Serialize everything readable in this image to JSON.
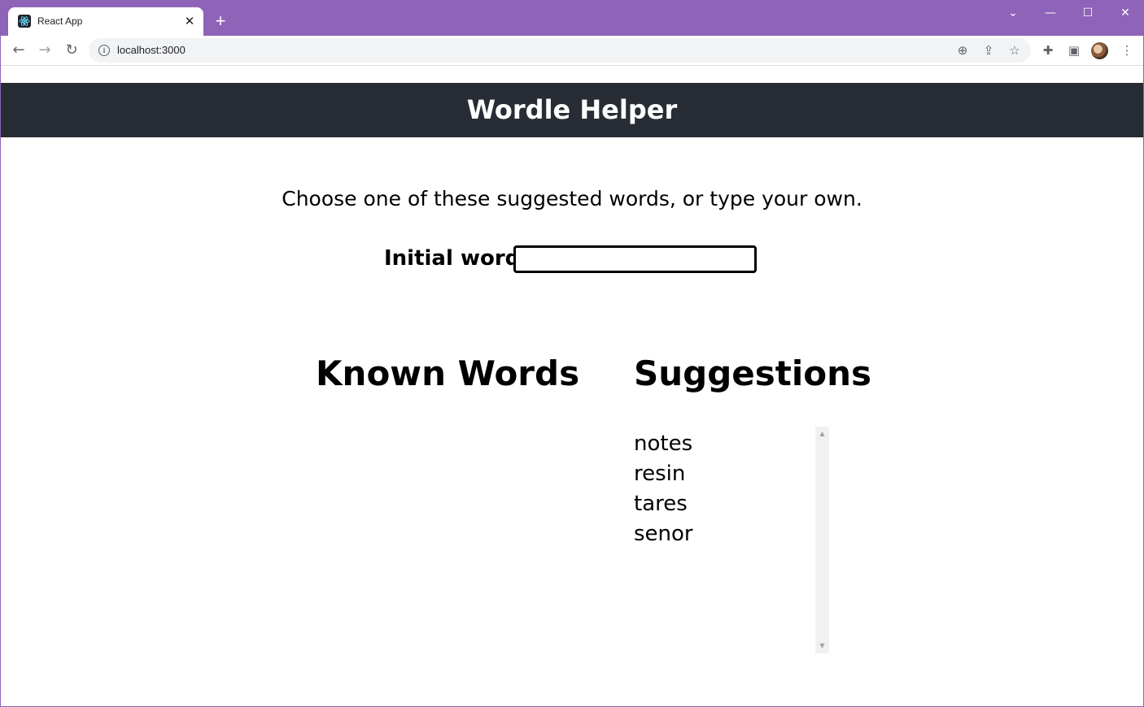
{
  "browser": {
    "tab_title": "React App",
    "tab_close": "✕",
    "new_tab": "+",
    "url": "localhost:3000",
    "window_controls": {
      "tab_search": "⌄",
      "minimize": "—",
      "maximize": "☐",
      "close": "✕"
    },
    "nav": {
      "back": "←",
      "forward": "→",
      "reload": "↻"
    },
    "omnibox_icons": {
      "zoom": "⊕",
      "share": "⇪",
      "bookmark": "☆"
    },
    "toolbar_icons": {
      "extensions": "✚",
      "side_panel": "▣",
      "menu": "⋮"
    }
  },
  "app": {
    "title": "Wordle Helper",
    "instructions": "Choose one of these suggested words, or type your own.",
    "initial_word_label": "Initial word",
    "initial_word_value": "",
    "known_words_heading": "Known Words",
    "suggestions_heading": "Suggestions",
    "suggestions": [
      "notes",
      "resin",
      "tares",
      "senor"
    ],
    "scroll_up": "▲",
    "scroll_down": "▼"
  }
}
